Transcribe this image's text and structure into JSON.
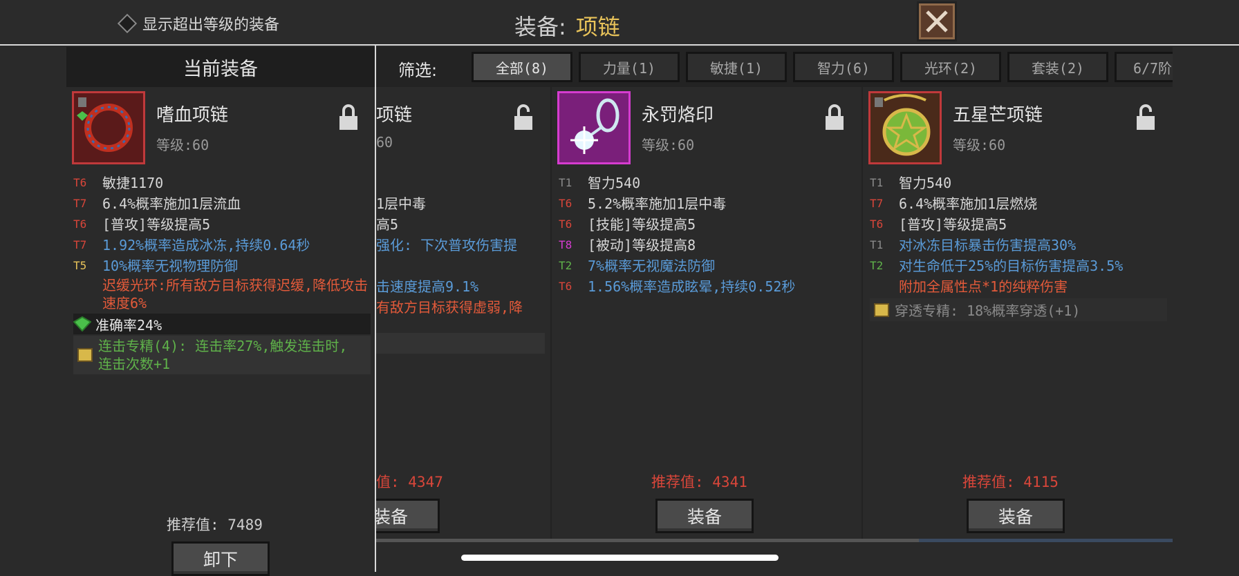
{
  "topbar": {
    "toggle_label": "显示超出等级的装备",
    "title_label": "装备:",
    "title_value": "项链"
  },
  "current": {
    "header": "当前装备",
    "name": "嗜血项链",
    "level": "等级:60",
    "stats": [
      {
        "tier": "T6",
        "tier_color": "red",
        "text": "敏捷1170",
        "color": "white"
      },
      {
        "tier": "T7",
        "tier_color": "red",
        "text": "6.4%概率施加1层流血",
        "color": "white"
      },
      {
        "tier": "T6",
        "tier_color": "red",
        "text": "[普攻]等级提高5",
        "color": "white"
      },
      {
        "tier": "T7",
        "tier_color": "red",
        "text": "1.92%概率造成冰冻,持续0.64秒",
        "color": "blue"
      },
      {
        "tier": "T5",
        "tier_color": "yellow",
        "text": "10%概率无视物理防御",
        "color": "blue"
      },
      {
        "tier": "",
        "tier_color": "red",
        "text": "迟缓光环:所有敌方目标获得迟缓,降低攻击速度6%",
        "color": "orange"
      }
    ],
    "gem": "准确率24%",
    "special": "连击专精(4): 连击率27%,触发连击时,连击次数+1",
    "recommend": "推荐值: 7489",
    "button": "卸下"
  },
  "filter": {
    "label": "筛选:",
    "tabs": [
      "全部(8)",
      "力量(1)",
      "敏捷(1)",
      "智力(6)",
      "光环(2)",
      "套装(2)",
      "6/7阶"
    ]
  },
  "cards": [
    {
      "name": "项链",
      "level": "60",
      "stats": [
        {
          "text": "1层中毒",
          "color": "white"
        },
        {
          "text": "高5",
          "color": "white"
        },
        {
          "text": "强化: 下次普攻伤害提",
          "color": "blue"
        },
        {
          "text": "击速度提高9.1%",
          "color": "blue"
        },
        {
          "text": "有敌方目标获得虚弱,降",
          "color": "orange"
        }
      ],
      "recommend": "值: 4347",
      "button": "装备"
    },
    {
      "name": "永罚烙印",
      "level": "等级:60",
      "stats": [
        {
          "tier": "T1",
          "tier_color": "grey",
          "text": "智力540",
          "color": "white"
        },
        {
          "tier": "T6",
          "tier_color": "red",
          "text": "5.2%概率施加1层中毒",
          "color": "white"
        },
        {
          "tier": "T6",
          "tier_color": "red",
          "text": "[技能]等级提高5",
          "color": "white"
        },
        {
          "tier": "T8",
          "tier_color": "pink",
          "text": "[被动]等级提高8",
          "color": "white"
        },
        {
          "tier": "T2",
          "tier_color": "green",
          "text": "7%概率无视魔法防御",
          "color": "blue"
        },
        {
          "tier": "T6",
          "tier_color": "red",
          "text": "1.56%概率造成眩晕,持续0.52秒",
          "color": "blue"
        }
      ],
      "recommend": "推荐值: 4341",
      "button": "装备"
    },
    {
      "name": "五星芒项链",
      "level": "等级:60",
      "stats": [
        {
          "tier": "T1",
          "tier_color": "grey",
          "text": "智力540",
          "color": "white"
        },
        {
          "tier": "T7",
          "tier_color": "red",
          "text": "6.4%概率施加1层燃烧",
          "color": "white"
        },
        {
          "tier": "T6",
          "tier_color": "red",
          "text": "[普攻]等级提高5",
          "color": "white"
        },
        {
          "tier": "T1",
          "tier_color": "grey",
          "text": "对冰冻目标暴击伤害提高30%",
          "color": "blue"
        },
        {
          "tier": "T2",
          "tier_color": "green",
          "text": "对生命低于25%的目标伤害提高3.5%",
          "color": "blue"
        },
        {
          "tier": "",
          "tier_color": "red",
          "text": "附加全属性点*1的纯粹伤害",
          "color": "orange"
        }
      ],
      "special": "穿透专精: 18%概率穿透(+1)",
      "recommend": "推荐值: 4115",
      "button": "装备"
    }
  ]
}
